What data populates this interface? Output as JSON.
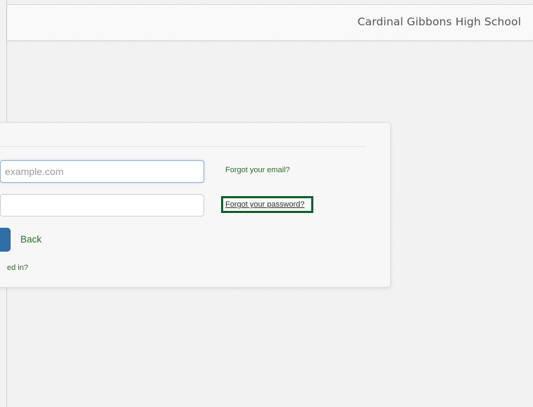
{
  "header": {
    "school_name": "Cardinal Gibbons High School"
  },
  "login_form": {
    "email_placeholder": "example.com",
    "password_value": "",
    "forgot_email_link": "Forgot your email?",
    "forgot_password_link": "Forgot your password?",
    "back_link": "Back",
    "help_link_fragment": "ed in?"
  },
  "colors": {
    "link_green": "#2e6b2e",
    "highlight_border": "#0f5f2c",
    "primary_button": "#2f6fa8"
  }
}
